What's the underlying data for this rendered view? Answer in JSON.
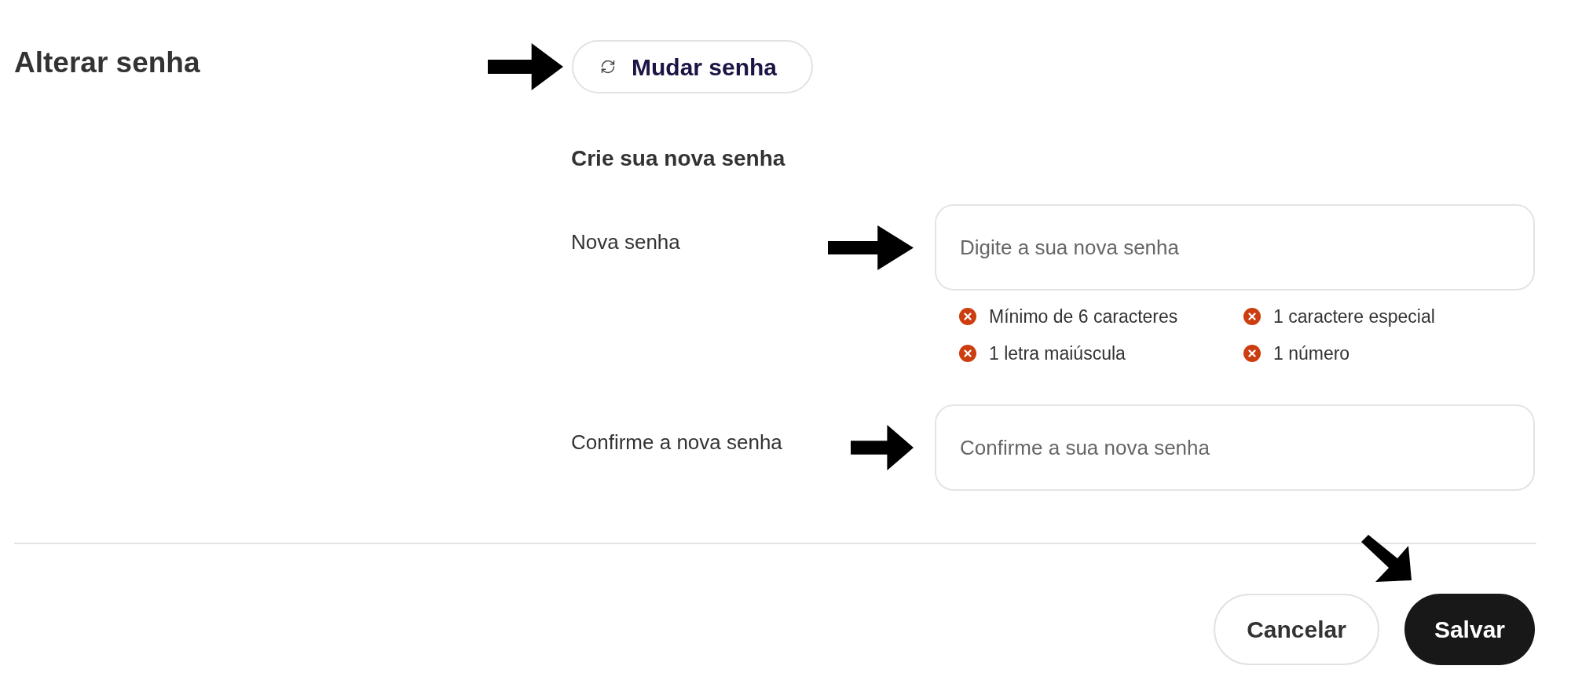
{
  "page": {
    "title": "Alterar senha"
  },
  "change_password_button": {
    "label": "Mudar senha"
  },
  "form": {
    "heading": "Crie sua nova senha",
    "fields": [
      {
        "label": "Nova senha",
        "placeholder": "Digite a sua nova senha",
        "requirements": [
          {
            "text": "Mínimo de 6 caracteres",
            "met": false
          },
          {
            "text": "1 caractere especial",
            "met": false
          },
          {
            "text": "1 letra maiúscula",
            "met": false
          },
          {
            "text": "1 número",
            "met": false
          }
        ]
      },
      {
        "label": "Confirme a nova senha",
        "placeholder": "Confirme a sua nova senha"
      }
    ]
  },
  "actions": [
    {
      "label": "Cancelar",
      "kind": "secondary"
    },
    {
      "label": "Salvar",
      "kind": "primary"
    }
  ]
}
